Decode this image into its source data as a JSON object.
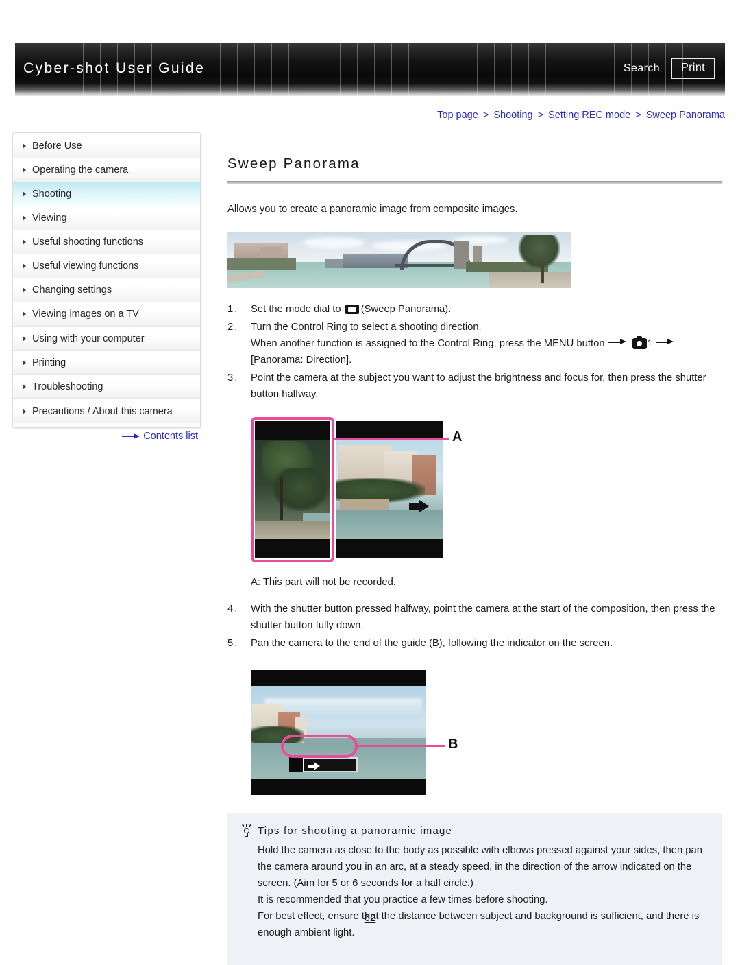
{
  "header": {
    "title": "Cyber-shot User Guide",
    "search_label": "Search",
    "print_label": "Print"
  },
  "breadcrumb": {
    "items": [
      "Top page",
      "Shooting",
      "Setting REC mode",
      "Sweep Panorama"
    ],
    "separator": ">"
  },
  "sidebar": {
    "items": [
      {
        "label": "Before Use",
        "active": false
      },
      {
        "label": "Operating the camera",
        "active": false
      },
      {
        "label": "Shooting",
        "active": true
      },
      {
        "label": "Viewing",
        "active": false
      },
      {
        "label": "Useful shooting functions",
        "active": false
      },
      {
        "label": "Useful viewing functions",
        "active": false
      },
      {
        "label": "Changing settings",
        "active": false
      },
      {
        "label": "Viewing images on a TV",
        "active": false
      },
      {
        "label": "Using with your computer",
        "active": false
      },
      {
        "label": "Printing",
        "active": false
      },
      {
        "label": "Troubleshooting",
        "active": false
      },
      {
        "label": "Precautions / About this camera",
        "active": false
      }
    ],
    "contents_link": "Contents list"
  },
  "main": {
    "title": "Sweep Panorama",
    "intro": "Allows you to create a panoramic image from composite images.",
    "panorama_image_alt": "Panoramic photo of Sydney Harbour Bridge",
    "steps": [
      {
        "num": "1.",
        "text_before_icon": "Set the mode dial to ",
        "icon": "sweep-panorama-mode-icon",
        "text_after_icon": "(Sweep Panorama)."
      },
      {
        "num": "2.",
        "text": "Turn the Control Ring to select a shooting direction.",
        "sub_before": "When another function is assigned to the Control Ring, press the MENU button",
        "sub_icon": "camera-settings-icon",
        "sub_icon_num": "1",
        "sub_after": "[Panorama: Direction]."
      },
      {
        "num": "3.",
        "text": "Point the camera at the subject you want to adjust the brightness and focus for, then press the shutter button halfway."
      },
      {
        "num": "4.",
        "text": "With the shutter button pressed halfway, point the camera at the start of the composition, then press the shutter button fully down."
      },
      {
        "num": "5.",
        "text": "Pan the camera to the end of the guide (B), following the indicator on the screen."
      }
    ],
    "figure_a": {
      "label": "A",
      "alt": "Camera screen showing the un-recorded left portion highlighted in pink"
    },
    "caption_a": "A: This part will not be recorded.",
    "figure_b": {
      "label": "B",
      "alt": "Camera screen showing the panorama guide bar highlighted in pink"
    }
  },
  "tips": {
    "icon": "lightbulb-icon",
    "heading": "Tips for shooting a panoramic image",
    "paragraphs": [
      "Hold the camera as close to the body as possible with elbows pressed against your sides, then pan the camera around you in an arc, at a steady speed, in the direction of the arrow indicated on the screen. (Aim for 5 or 6 seconds for a half circle.)",
      "It is recommended that you practice a few times before shooting.",
      "For best effect, ensure that the distance between subject and background is sufficient, and there is enough ambient light."
    ]
  },
  "footer": {
    "page_number": "62"
  },
  "colors": {
    "accent_link": "#2b2bbf",
    "highlight_pink": "#ec4b9b",
    "sidebar_active": "#bfeaf4",
    "tips_background": "#eef1f6"
  }
}
